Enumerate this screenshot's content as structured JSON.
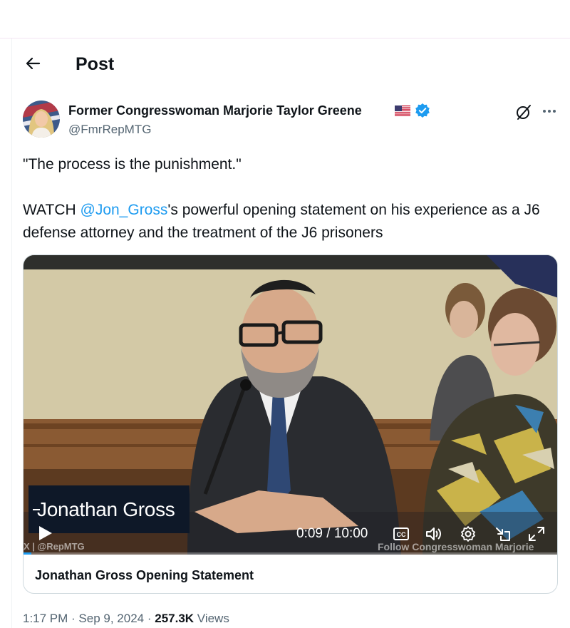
{
  "header": {
    "title": "Post"
  },
  "author": {
    "name": "Former Congresswoman Marjorie Taylor Greene",
    "handle": "@FmrRepMTG",
    "verified_color": "#1d9bf0"
  },
  "tweet": {
    "line1": "\"The process is the punishment.\"",
    "watch": "WATCH",
    "mention": "@Jon_Gross",
    "rest": "'s powerful opening statement on his experience as a J6 defense attorney and the treatment of the J6 prisoners"
  },
  "video": {
    "lower_third": "Jonathan Gross",
    "time": "0:09 / 10:00",
    "watermark_left": "X | @RepMTG",
    "watermark_right": "Follow Congresswoman Marjorie",
    "progress": 0.015,
    "caption": "Jonathan Gross Opening Statement",
    "icons": [
      "play-icon",
      "captions-icon",
      "volume-icon",
      "settings-icon",
      "pip-icon",
      "fullscreen-icon"
    ]
  },
  "meta": {
    "time": "1:17 PM",
    "sep": " · ",
    "date": "Sep 9, 2024",
    "views_count": "257.3K",
    "views_label": " Views"
  },
  "colors": {
    "accent": "#1d9bf0",
    "text": "#0f1419",
    "secondary": "#536471"
  }
}
